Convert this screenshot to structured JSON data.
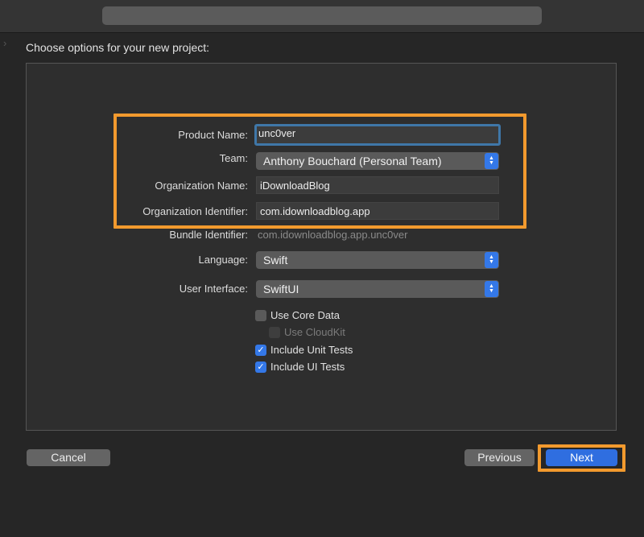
{
  "window": {
    "heading": "Choose options for your new project:"
  },
  "form": {
    "product_name": {
      "label": "Product Name:",
      "value": "unc0ver"
    },
    "team": {
      "label": "Team:",
      "value": "Anthony Bouchard (Personal Team)"
    },
    "organization_name": {
      "label": "Organization Name:",
      "value": "iDownloadBlog"
    },
    "organization_identifier": {
      "label": "Organization Identifier:",
      "value": "com.idownloadblog.app"
    },
    "bundle_identifier": {
      "label": "Bundle Identifier:",
      "value": "com.idownloadblog.app.unc0ver"
    },
    "language": {
      "label": "Language:",
      "value": "Swift"
    },
    "user_interface": {
      "label": "User Interface:",
      "value": "SwiftUI"
    }
  },
  "options": {
    "use_core_data": {
      "label": "Use Core Data",
      "checked": false
    },
    "use_cloudkit": {
      "label": "Use CloudKit",
      "checked": false,
      "enabled": false
    },
    "include_unit_tests": {
      "label": "Include Unit Tests",
      "checked": true
    },
    "include_ui_tests": {
      "label": "Include UI Tests",
      "checked": true
    }
  },
  "buttons": {
    "cancel": "Cancel",
    "previous": "Previous",
    "next": "Next"
  },
  "colors": {
    "highlight": "#f29a2e",
    "accent": "#3478e8"
  }
}
